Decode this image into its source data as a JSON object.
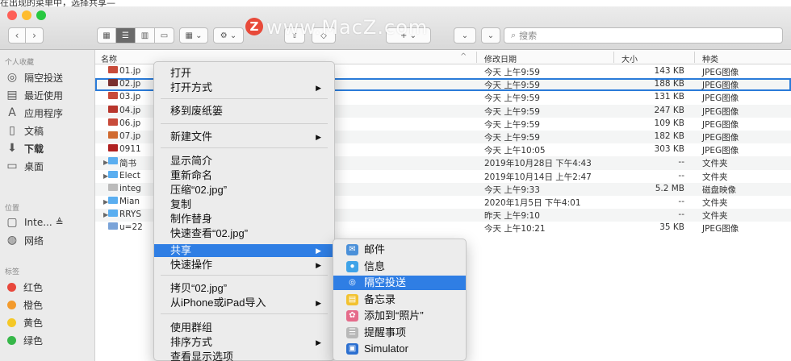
{
  "top_text": "在出现的菜单中，选择共享—",
  "watermark": "www.MacZ.com",
  "watermark_badge": "Z",
  "search_placeholder": "搜索",
  "sidebar": {
    "sec_fav": "个人收藏",
    "fav": [
      {
        "label": "隔空投送",
        "icon": "airdrop-icon",
        "glyph": "◎"
      },
      {
        "label": "最近使用",
        "icon": "recents-icon",
        "glyph": "▤"
      },
      {
        "label": "应用程序",
        "icon": "applications-icon",
        "glyph": "A"
      },
      {
        "label": "文稿",
        "icon": "documents-icon",
        "glyph": "▯"
      },
      {
        "label": "下载",
        "icon": "downloads-icon",
        "glyph": "⬇"
      },
      {
        "label": "桌面",
        "icon": "desktop-icon",
        "glyph": "▭"
      }
    ],
    "sec_loc": "位置",
    "loc": [
      {
        "label": "Inte... ≜",
        "icon": "disk-icon",
        "glyph": "▢"
      },
      {
        "label": "网络",
        "icon": "network-icon",
        "glyph": "◍"
      }
    ],
    "sec_tags": "标签",
    "tags": [
      {
        "label": "红色",
        "color": "#e8473c"
      },
      {
        "label": "橙色",
        "color": "#f39a2c"
      },
      {
        "label": "黄色",
        "color": "#f5c826"
      },
      {
        "label": "绿色",
        "color": "#36b749"
      }
    ]
  },
  "columns": {
    "name": "名称",
    "sort": "^",
    "date": "修改日期",
    "size": "大小",
    "kind": "种类"
  },
  "rows": [
    {
      "tri": "",
      "name": "01.jp",
      "date": "今天 上午9:59",
      "size": "143 KB",
      "kind": "JPEG图像",
      "ic": "#c84b3a"
    },
    {
      "tri": "",
      "name": "02.jp",
      "date": "今天 上午9:59",
      "size": "188 KB",
      "kind": "JPEG图像",
      "ic": "#7a3030"
    },
    {
      "tri": "",
      "name": "03.jp",
      "date": "今天 上午9:59",
      "size": "131 KB",
      "kind": "JPEG图像",
      "ic": "#c84b3a"
    },
    {
      "tri": "",
      "name": "04.jp",
      "date": "今天 上午9:59",
      "size": "247 KB",
      "kind": "JPEG图像",
      "ic": "#b8352c"
    },
    {
      "tri": "",
      "name": "06.jp",
      "date": "今天 上午9:59",
      "size": "109 KB",
      "kind": "JPEG图像",
      "ic": "#c84b3a"
    },
    {
      "tri": "",
      "name": "07.jp",
      "date": "今天 上午9:59",
      "size": "182 KB",
      "kind": "JPEG图像",
      "ic": "#d06a30"
    },
    {
      "tri": "",
      "name": "0911",
      "date": "今天 上午10:05",
      "size": "303 KB",
      "kind": "JPEG图像",
      "ic": "#b02020"
    },
    {
      "tri": "▶",
      "name": "简书",
      "date": "2019年10月28日 下午4:43",
      "size": "--",
      "kind": "文件夹",
      "ic": "#5aaef0"
    },
    {
      "tri": "▶",
      "name": "Elect",
      "date": "2019年10月14日 上午2:47",
      "size": "--",
      "kind": "文件夹",
      "ic": "#5aaef0"
    },
    {
      "tri": "",
      "name": "integ",
      "date": "今天 上午9:33",
      "size": "5.2 MB",
      "kind": "磁盘映像",
      "ic": "#bbbbbb"
    },
    {
      "tri": "▶",
      "name": "Mian",
      "date": "2020年1月5日 下午4:01",
      "size": "--",
      "kind": "文件夹",
      "ic": "#5aaef0"
    },
    {
      "tri": "▶",
      "name": "RRYS",
      "date": "昨天 上午9:10",
      "size": "--",
      "kind": "文件夹",
      "ic": "#5aaef0"
    },
    {
      "tri": "",
      "name": "u=22",
      "date": "今天 上午10:21",
      "size": "35 KB",
      "kind": "JPEG图像",
      "ic": "#7aa3d8"
    }
  ],
  "menu": {
    "open": "打开",
    "open_with": "打开方式",
    "trash": "移到废纸篓",
    "new_file": "新建文件",
    "info": "显示简介",
    "rename": "重新命名",
    "compress": "压缩“02.jpg”",
    "duplicate": "复制",
    "alias": "制作替身",
    "quicklook": "快速查看“02.jpg”",
    "share": "共享",
    "quick_actions": "快速操作",
    "copy": "拷贝“02.jpg”",
    "import": "从iPhone或iPad导入",
    "groups": "使用群组",
    "sort": "排序方式",
    "view_opts": "查看显示选项"
  },
  "submenu": [
    {
      "label": "邮件",
      "icon": "mail-icon",
      "bg": "#4a90d9",
      "g": "✉"
    },
    {
      "label": "信息",
      "icon": "messages-icon",
      "bg": "#3fa3e8",
      "g": "●"
    },
    {
      "label": "隔空投送",
      "icon": "airdrop-icon",
      "bg": "#2f7ee4",
      "g": "◎"
    },
    {
      "label": "备忘录",
      "icon": "notes-icon",
      "bg": "#f2c230",
      "g": "▤"
    },
    {
      "label": "添加到“照片”",
      "icon": "photos-icon",
      "bg": "#e56b8a",
      "g": "✿"
    },
    {
      "label": "提醒事项",
      "icon": "reminders-icon",
      "bg": "#b8b8b8",
      "g": "☰"
    },
    {
      "label": "Simulator",
      "icon": "simulator-icon",
      "bg": "#2b6fd0",
      "g": "▣"
    }
  ]
}
